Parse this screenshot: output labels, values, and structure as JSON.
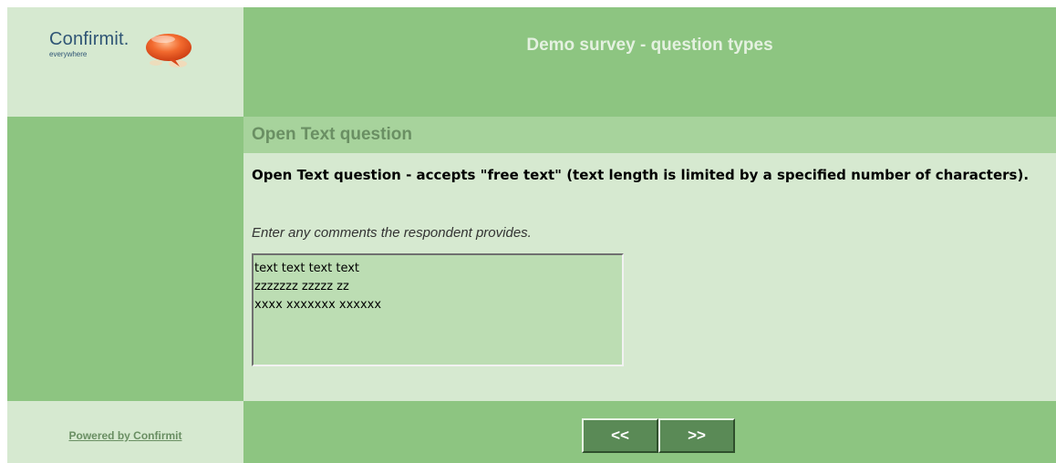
{
  "logo": {
    "wordmark": "Confirmit.",
    "tagline": "everywhere",
    "icon": "orange-speech-bubble-logo-icon"
  },
  "header": {
    "title": "Demo survey - question types"
  },
  "question": {
    "heading": "Open Text question",
    "text": "Open Text question - accepts \"free text\" (text length is limited by a specified number of characters).",
    "instruction": "Enter any comments the respondent provides.",
    "answer_value": "text text text text\nzzzzzzz zzzzz zz\nxxxx xxxxxxx xxxxxx"
  },
  "footer": {
    "powered_by": "Powered by Confirmit",
    "back_label": "<<",
    "next_label": ">>"
  },
  "colors": {
    "dark_green": "#8dc581",
    "light_green": "#d6e9d0",
    "mid_green": "#a7d39c",
    "button_green": "#5a8a56",
    "logo_orange": "#e8571f"
  }
}
